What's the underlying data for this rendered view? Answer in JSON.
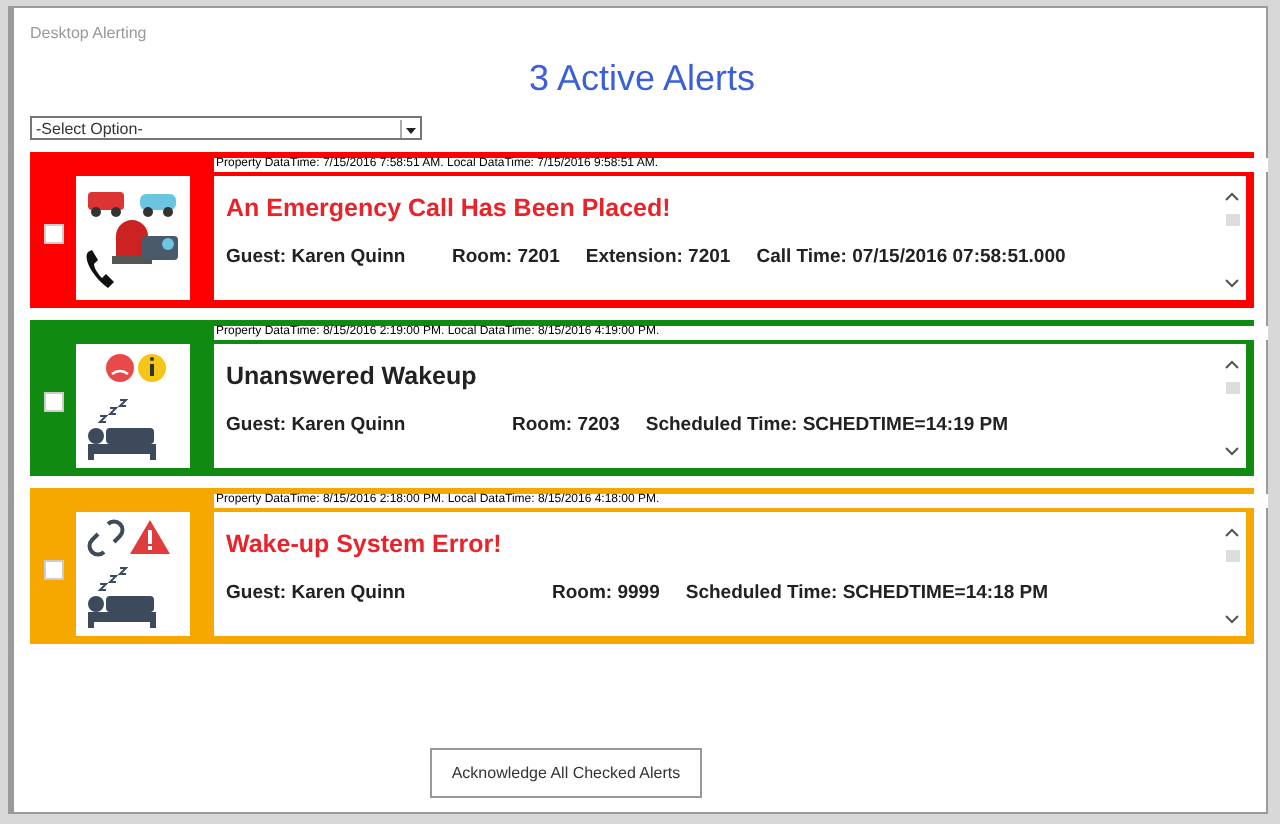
{
  "window": {
    "title": "Desktop Alerting"
  },
  "heading": "3 Active Alerts",
  "filter": {
    "value": "-Select Option-"
  },
  "alerts": [
    {
      "kind": "emergency",
      "color": "#ff0000",
      "checked": false,
      "urgent": true,
      "timestamp": "Property DataTime: 7/15/2016 7:58:51 AM.  Local DataTime: 7/15/2016 9:58:51 AM.",
      "title": "An Emergency Call Has Been Placed!",
      "details": [
        "Guest: Karen Quinn",
        "Room: 7201",
        "Extension: 7201",
        "Call Time: 07/15/2016 07:58:51.000"
      ]
    },
    {
      "kind": "wakeup",
      "color": "#108a10",
      "checked": false,
      "urgent": false,
      "timestamp": "Property DataTime: 8/15/2016 2:19:00 PM.  Local DataTime: 8/15/2016 4:19:00 PM.",
      "title": "Unanswered Wakeup",
      "details": [
        "Guest: Karen Quinn",
        "Room: 7203",
        "Scheduled Time: SCHEDTIME=14:19 PM"
      ]
    },
    {
      "kind": "error",
      "color": "#f7a800",
      "checked": false,
      "urgent": true,
      "timestamp": "Property DataTime: 8/15/2016 2:18:00 PM.  Local DataTime: 8/15/2016 4:18:00 PM.",
      "title": "Wake-up System Error!",
      "details": [
        "Guest: Karen Quinn",
        "Room: 9999",
        "Scheduled Time: SCHEDTIME=14:18 PM"
      ]
    }
  ],
  "acknowledge_button": "Acknowledge All Checked Alerts"
}
